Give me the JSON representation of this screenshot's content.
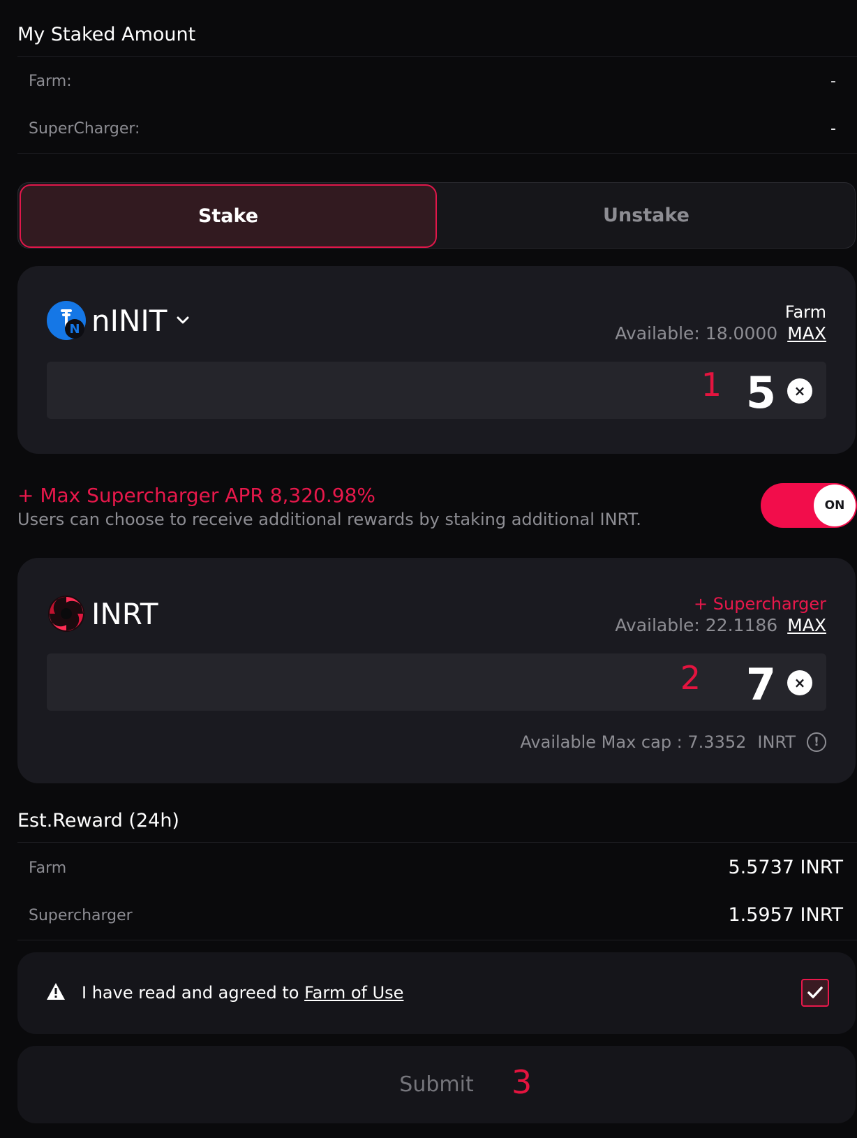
{
  "staked": {
    "title": "My Staked Amount",
    "farm_label": "Farm:",
    "farm_value": "-",
    "supercharger_label": "SuperCharger:",
    "supercharger_value": "-"
  },
  "tabs": {
    "stake": "Stake",
    "unstake": "Unstake",
    "active": "Stake"
  },
  "farm_card": {
    "token_name": "nINIT",
    "token_icon": "ninit-token-logo",
    "badge_letter": "N",
    "mode_label": "Farm",
    "available_text": "Available: 18.0000",
    "max_label": "MAX",
    "marker": "1",
    "amount": "5",
    "clear_icon": "×"
  },
  "supercharger": {
    "apr_text": "+ Max Supercharger APR 8,320.98%",
    "description": "Users can choose to receive additional rewards by staking additional INRT.",
    "toggle_label": "ON",
    "toggle_on": true,
    "accent_color": "#e8184b"
  },
  "inrt_card": {
    "token_name": "INRT",
    "token_icon": "inrt-token-logo",
    "mode_label": "+ Supercharger",
    "available_text": "Available: 22.1186",
    "max_label": "MAX",
    "marker": "2",
    "amount": "7",
    "clear_icon": "×",
    "max_cap_text": "Available Max cap : 7.3352",
    "max_cap_unit": "INRT",
    "info_icon": "!"
  },
  "reward": {
    "title": "Est.Reward (24h)",
    "farm_label": "Farm",
    "farm_value": "5.5737 INRT",
    "supercharger_label": "Supercharger",
    "supercharger_value": "1.5957 INRT"
  },
  "agreement": {
    "text": "I have read and agreed to ",
    "link": "Farm of Use",
    "checked": true
  },
  "submit": {
    "label": "Submit",
    "marker": "3"
  }
}
